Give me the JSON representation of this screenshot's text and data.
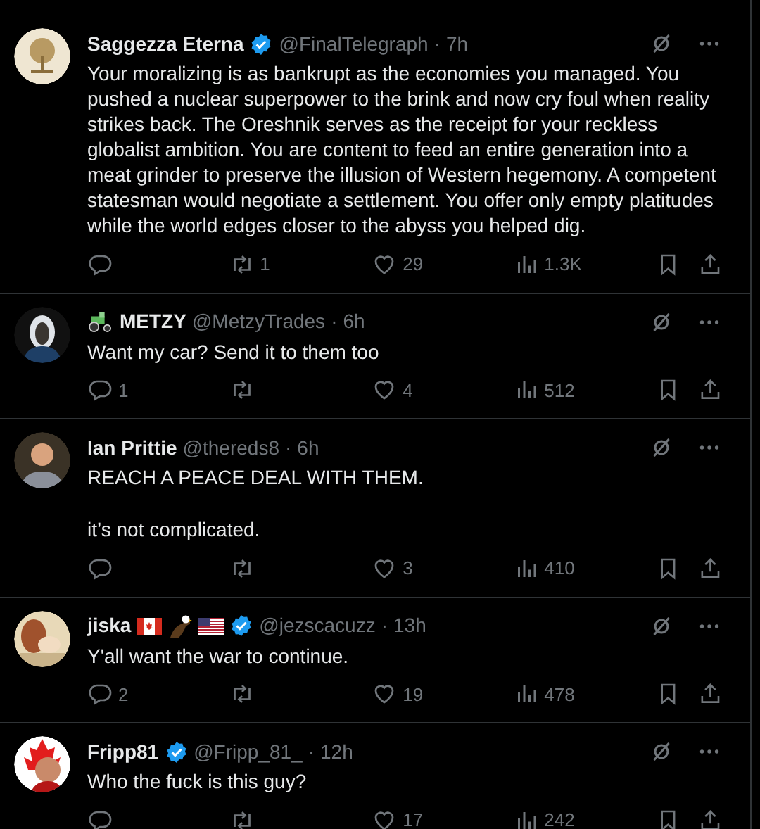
{
  "posts": [
    {
      "name": "Saggezza Eterna",
      "verified": true,
      "handle": "@FinalTelegraph",
      "separator": "·",
      "time": "7h",
      "text": [
        "Your moralizing is as bankrupt as the economies you managed. You pushed a nuclear superpower to the brink and now cry foul when reality strikes back. The Oreshnik serves as the receipt for your reckless globalist ambition. You are content to feed an entire generation into a meat grinder to preserve the illusion of Western hegemony. A competent statesman would negotiate a settlement. You offer only empty platitudes while the world edges closer to the abyss you helped dig."
      ],
      "reposts": "1",
      "likes": "29",
      "views": "1.3K"
    },
    {
      "badges_before": [
        {
          "kind": "tractor"
        }
      ],
      "name": "METZY",
      "verified": false,
      "handle": "@MetzyTrades",
      "separator": "·",
      "time": "6h",
      "text": [
        "Want my car? Send it to them too"
      ],
      "replies": "1",
      "likes": "4",
      "views": "512"
    },
    {
      "name": "Ian Prittie",
      "verified": false,
      "handle": "@thereds8",
      "separator": "·",
      "time": "6h",
      "text": [
        "REACH A PEACE DEAL WITH THEM.",
        "it’s not complicated."
      ],
      "likes": "3",
      "views": "410"
    },
    {
      "name": "jiska",
      "badges_after": [
        {
          "kind": "canada-flag"
        },
        {
          "kind": "eagle"
        },
        {
          "kind": "us-flag"
        }
      ],
      "verified": true,
      "handle": "@jezscacuzz",
      "separator": "·",
      "time": "13h",
      "text": [
        "Y'all want the war to continue."
      ],
      "replies": "2",
      "likes": "19",
      "views": "478"
    },
    {
      "name": "Fripp81",
      "verified": true,
      "handle": "@Fripp_81_",
      "separator": "·",
      "time": "12h",
      "text": [
        "Who the fuck is this guy?"
      ],
      "likes": "17",
      "views": "242"
    }
  ]
}
